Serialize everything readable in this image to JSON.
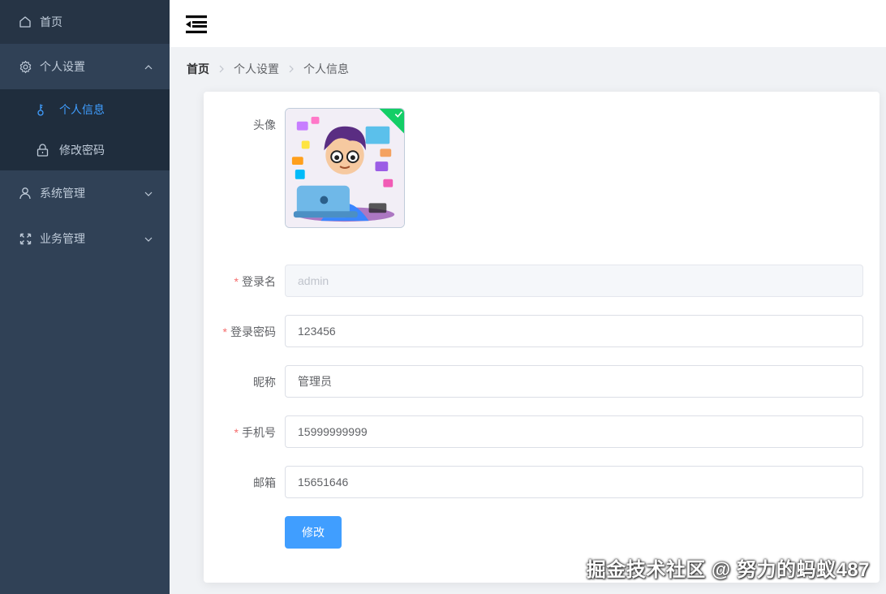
{
  "sidebar": {
    "items": [
      {
        "label": "首页"
      },
      {
        "label": "个人设置"
      },
      {
        "label": "系统管理"
      },
      {
        "label": "业务管理"
      }
    ],
    "sub_items": [
      {
        "label": "个人信息"
      },
      {
        "label": "修改密码"
      }
    ]
  },
  "breadcrumb": [
    "首页",
    "个人设置",
    "个人信息"
  ],
  "form": {
    "avatar_label": "头像",
    "login_name_label": "登录名",
    "login_name_value": "admin",
    "password_label": "登录密码",
    "password_value": "123456",
    "nickname_label": "昵称",
    "nickname_value": "管理员",
    "phone_label": "手机号",
    "phone_value": "15999999999",
    "email_label": "邮箱",
    "email_value": "15651646",
    "submit_label": "修改"
  },
  "watermark": "掘金技术社区 @ 努力的蚂蚁487",
  "colors": {
    "sidebar_bg": "#304156",
    "active": "#409eff",
    "required": "#f56c6c",
    "success": "#13ce66"
  }
}
